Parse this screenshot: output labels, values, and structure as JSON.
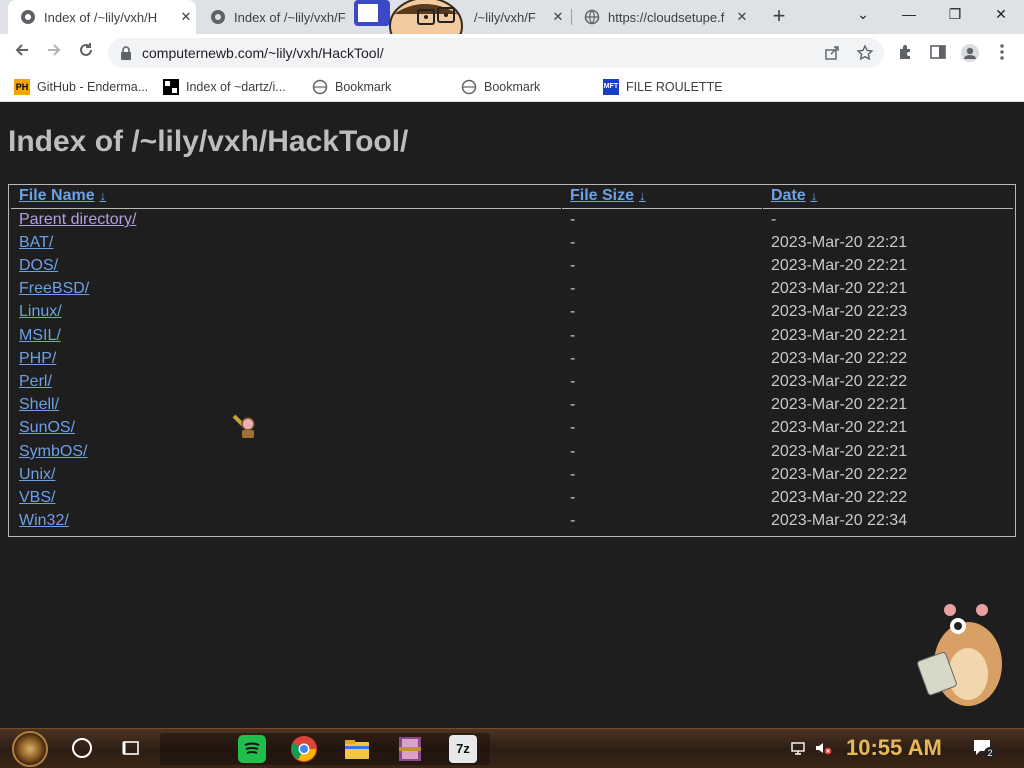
{
  "tabs": [
    {
      "title": "Index of /~lily/vxh/H",
      "active": true
    },
    {
      "title": "Index of /~lily/vxh/F",
      "active": false
    },
    {
      "title": "/~lily/vxh/F",
      "active": false
    },
    {
      "title": "https://cloudsetupe.f",
      "active": false
    }
  ],
  "window": {
    "minimize": "—",
    "restore": "❐",
    "close": "✕",
    "tab_menu": "⌄",
    "new_tab": "+",
    "tab_close": "✕"
  },
  "address": {
    "url": "computernewb.com/~lily/vxh/HackTool/"
  },
  "bookmarks": [
    {
      "label": "GitHub - Enderma...",
      "icon": "PH"
    },
    {
      "label": "Index of ~dartz/i...",
      "icon": "grid"
    },
    {
      "label": "Bookmark",
      "icon": "globe"
    },
    {
      "label": "Bookmark",
      "icon": "globe"
    },
    {
      "label": "FILE ROULETTE",
      "icon": "MFT"
    }
  ],
  "page": {
    "heading": "Index of /~lily/vxh/HackTool/",
    "columns": {
      "name": "File Name",
      "size": "File Size",
      "date": "Date",
      "sort_arrow": "↓"
    },
    "rows": [
      {
        "name": "Parent directory/",
        "size": "-",
        "date": "-"
      },
      {
        "name": "BAT/",
        "size": "-",
        "date": "2023-Mar-20 22:21"
      },
      {
        "name": "DOS/",
        "size": "-",
        "date": "2023-Mar-20 22:21"
      },
      {
        "name": "FreeBSD/",
        "size": "-",
        "date": "2023-Mar-20 22:21"
      },
      {
        "name": "Linux/",
        "size": "-",
        "date": "2023-Mar-20 22:23"
      },
      {
        "name": "MSIL/",
        "size": "-",
        "date": "2023-Mar-20 22:21"
      },
      {
        "name": "PHP/",
        "size": "-",
        "date": "2023-Mar-20 22:22"
      },
      {
        "name": "Perl/",
        "size": "-",
        "date": "2023-Mar-20 22:22"
      },
      {
        "name": "Shell/",
        "size": "-",
        "date": "2023-Mar-20 22:21"
      },
      {
        "name": "SunOS/",
        "size": "-",
        "date": "2023-Mar-20 22:21"
      },
      {
        "name": "SymbOS/",
        "size": "-",
        "date": "2023-Mar-20 22:21"
      },
      {
        "name": "Unix/",
        "size": "-",
        "date": "2023-Mar-20 22:22"
      },
      {
        "name": "VBS/",
        "size": "-",
        "date": "2023-Mar-20 22:22"
      },
      {
        "name": "Win32/",
        "size": "-",
        "date": "2023-Mar-20 22:34"
      }
    ]
  },
  "taskbar": {
    "clock": "10:55 AM",
    "notification_count": "2",
    "pinned": [
      "spotify-icon",
      "chrome-icon",
      "file-explorer-icon",
      "winrar-icon",
      "7zip-icon"
    ],
    "sevenzip_label": "7z"
  },
  "colors": {
    "link": "#6ea0e6",
    "visited": "#b49de0",
    "page_bg": "#1e1e1e",
    "heading": "#bdbdbd",
    "clock": "#e7b85a"
  }
}
